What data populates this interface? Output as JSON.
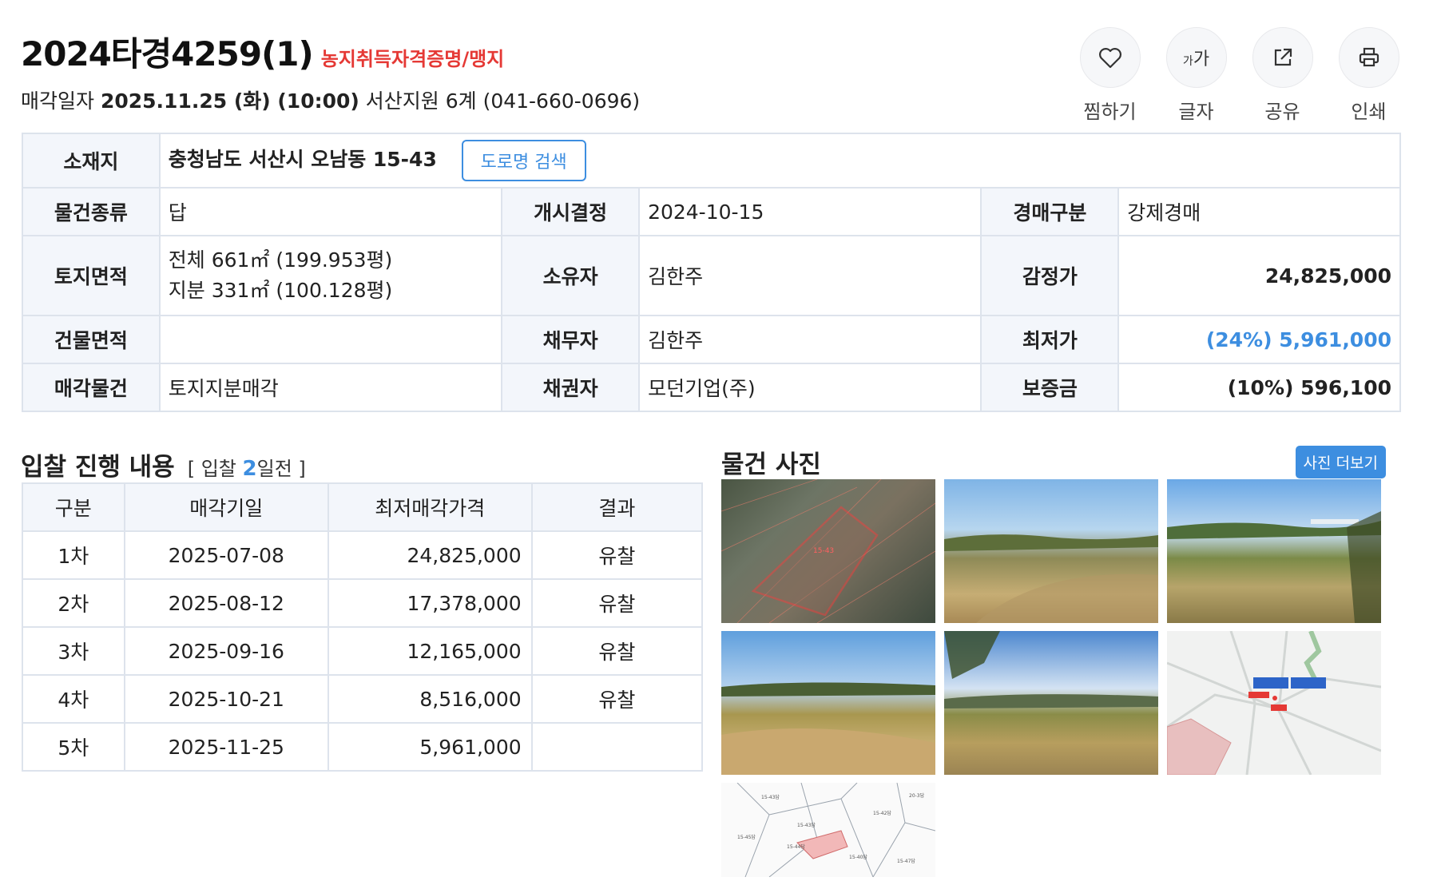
{
  "header": {
    "case_no": "2024타경4259(1)",
    "tag": "농지취득자격증명/맹지",
    "sale_label": "매각일자",
    "sale_date": "2025.11.25 (화) (10:00)",
    "court": "서산지원 6계 (041-660-0696)"
  },
  "actions": [
    {
      "label": "찜하기",
      "icon": "heart-icon"
    },
    {
      "label": "글자",
      "icon": "font-size-icon"
    },
    {
      "label": "공유",
      "icon": "share-icon"
    },
    {
      "label": "인쇄",
      "icon": "print-icon"
    }
  ],
  "font_glyph": {
    "small": "가",
    "big": "가"
  },
  "info": {
    "location_label": "소재지",
    "location": "충청남도 서산시 오남동 15-43",
    "road_btn": "도로명 검색",
    "rows": [
      {
        "l1": "물건종류",
        "v1": "답",
        "l2": "개시결정",
        "v2": "2024-10-15",
        "l3": "경매구분",
        "v3": "강제경매"
      },
      {
        "l1": "토지면적",
        "v1": "전체 661㎡ (199.953평)",
        "v1b": "지분 331㎡ (100.128평)",
        "l2": "소유자",
        "v2": "김한주",
        "l3": "감정가",
        "v3": "24,825,000"
      },
      {
        "l1": "건물면적",
        "v1": "",
        "l2": "채무자",
        "v2": "김한주",
        "l3": "최저가",
        "v3": "(24%) 5,961,000"
      },
      {
        "l1": "매각물건",
        "v1": "토지지분매각",
        "l2": "채권자",
        "v2": "모던기업(주)",
        "l3": "보증금",
        "v3": "(10%) 596,100"
      }
    ]
  },
  "bid": {
    "title": "입찰 진행 내용",
    "sub_pre": "[ 입찰",
    "sub_num": "2",
    "sub_post": "일전 ]",
    "headers": [
      "구분",
      "매각기일",
      "최저매각가격",
      "결과"
    ],
    "rows": [
      {
        "round": "1차",
        "date": "2025-07-08",
        "price": "24,825,000",
        "result": "유찰"
      },
      {
        "round": "2차",
        "date": "2025-08-12",
        "price": "17,378,000",
        "result": "유찰"
      },
      {
        "round": "3차",
        "date": "2025-09-16",
        "price": "12,165,000",
        "result": "유찰"
      },
      {
        "round": "4차",
        "date": "2025-10-21",
        "price": "8,516,000",
        "result": "유찰"
      },
      {
        "round": "5차",
        "date": "2025-11-25",
        "price": "5,961,000",
        "result": ""
      }
    ]
  },
  "photos": {
    "title": "물건 사진",
    "more": "사진 더보기",
    "map_parcel": "15-43",
    "labels": [
      "15-43답",
      "15-43답",
      "15-44답",
      "15-42답",
      "20-3답",
      "15-40답",
      "15-45답",
      "15-47답"
    ]
  },
  "colors": {
    "accent": "#3d8ee0",
    "tag_red": "#e53935",
    "header_bg": "#f3f6fb",
    "border": "#dde3ec"
  }
}
